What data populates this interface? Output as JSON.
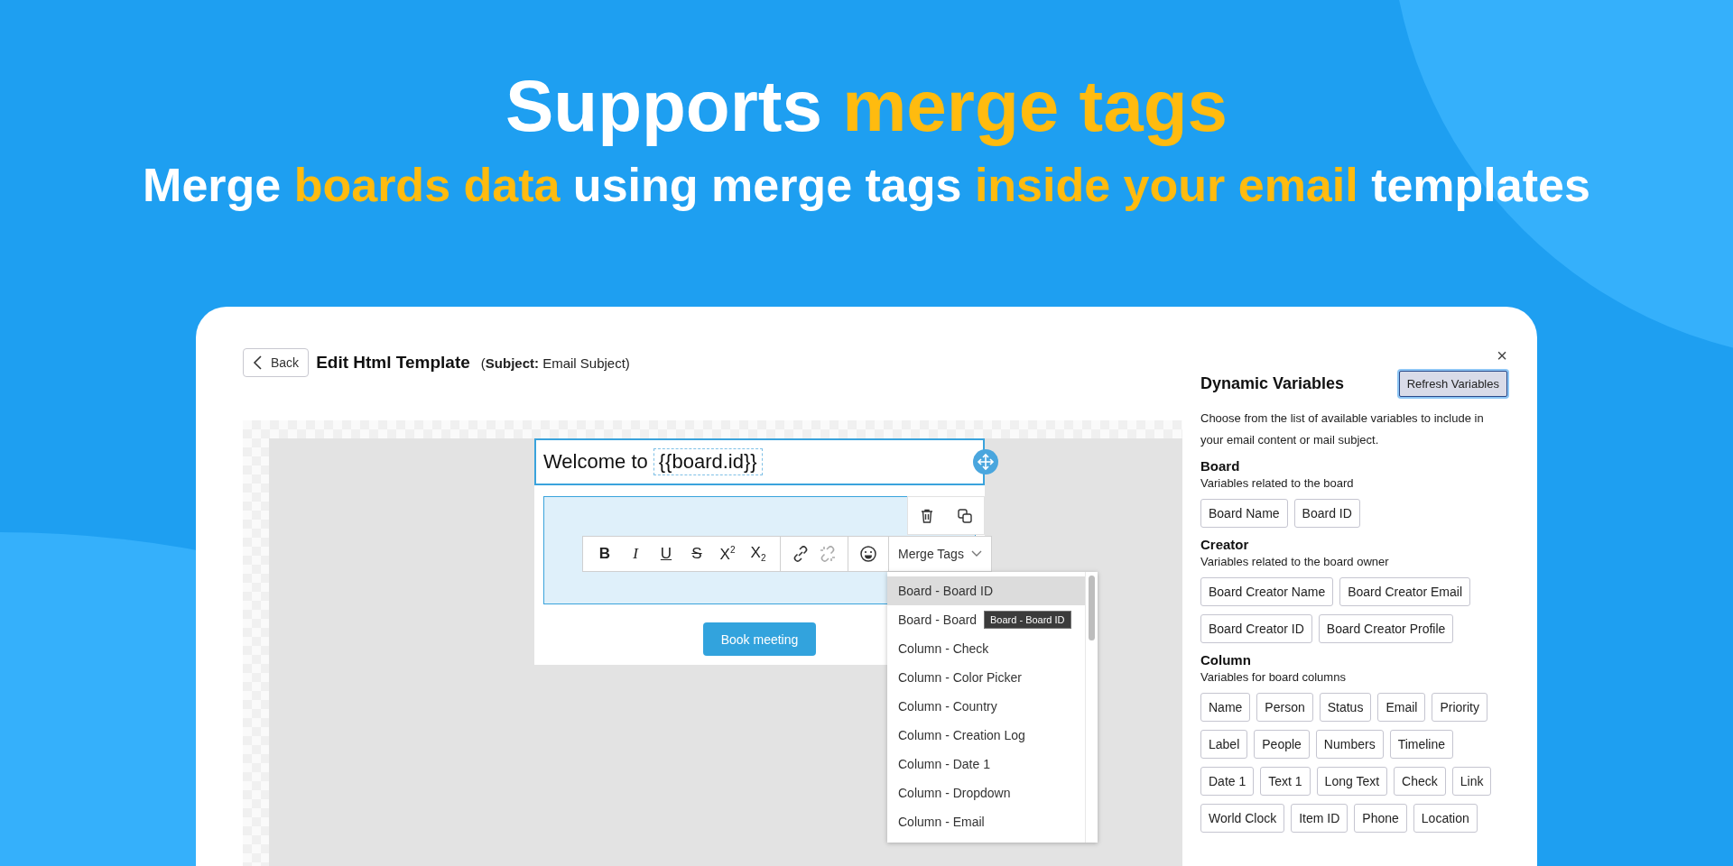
{
  "headline": [
    {
      "text": "Supports ",
      "highlight": false
    },
    {
      "text": "merge tags",
      "highlight": true
    }
  ],
  "subheadline": [
    {
      "text": "Merge ",
      "highlight": false
    },
    {
      "text": "boards data",
      "highlight": true
    },
    {
      "text": " using merge tags ",
      "highlight": false
    },
    {
      "text": "inside your email",
      "highlight": true
    },
    {
      "text": " templates",
      "highlight": false
    }
  ],
  "editor": {
    "back": "Back",
    "title": "Edit Html Template",
    "subject_label": "(**Subject:** Email Subject)",
    "heading_text": "Welcome to",
    "heading_tag": "{{board.id}}",
    "toolbar": [
      {
        "kind": "bold",
        "label": "B"
      },
      {
        "kind": "italic",
        "label": "I"
      },
      {
        "kind": "underline",
        "label": "U"
      },
      {
        "kind": "strike",
        "label": "S"
      },
      {
        "kind": "script",
        "label": "X$^{2}$"
      },
      {
        "kind": "script",
        "label": "X$_{2}$"
      }
    ],
    "merge_tags_button": "Merge Tags",
    "merge_tags": [
      {
        "label": "Board - Board ID",
        "selected": true
      },
      {
        "label": "Board - Board",
        "selected": false
      },
      {
        "label": "Column - Check",
        "selected": false
      },
      {
        "label": "Column - Color Picker",
        "selected": false
      },
      {
        "label": "Column - Country",
        "selected": false
      },
      {
        "label": "Column - Creation Log",
        "selected": false
      },
      {
        "label": "Column - Date 1",
        "selected": false
      },
      {
        "label": "Column - Dropdown",
        "selected": false
      },
      {
        "label": "Column - Email",
        "selected": false
      }
    ],
    "tooltip": "Board - Board ID",
    "cta_button": "Book meeting"
  },
  "panel": {
    "close": "×",
    "title": "Dynamic Variables",
    "refresh": "Refresh Variables",
    "description": "Choose from the list of available variables to include in your email content or mail subject.",
    "sections": [
      {
        "title": "Board",
        "subtitle": "Variables related to the board",
        "variables": [
          "Board Name",
          "Board ID"
        ]
      },
      {
        "title": "Creator",
        "subtitle": "Variables related to the board owner",
        "variables": [
          "Board Creator Name",
          "Board Creator Email",
          "Board Creator ID",
          "Board Creator Profile"
        ]
      },
      {
        "title": "Column",
        "subtitle": "Variables for board columns",
        "variables": [
          "Name",
          "Person",
          "Status",
          "Email",
          "Priority",
          "Label",
          "People",
          "Numbers",
          "Timeline",
          "Date 1",
          "Text 1",
          "Long Text",
          "Check",
          "Link",
          "World Clock",
          "Item ID",
          "Phone",
          "Location"
        ]
      }
    ]
  }
}
